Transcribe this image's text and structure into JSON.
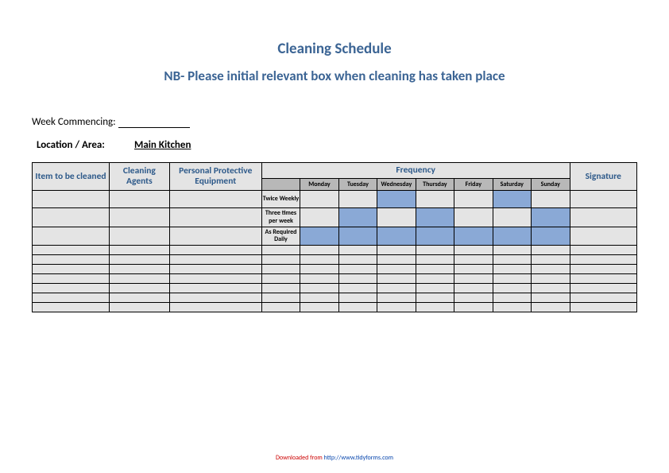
{
  "title": "Cleaning Schedule",
  "subtitle": "NB- Please initial relevant box when cleaning has taken place",
  "week_label": "Week Commencing:",
  "location_label": "Location / Area:",
  "location_value": "Main Kitchen",
  "headers": {
    "item": "Item to be cleaned",
    "agents": "Cleaning Agents",
    "ppe": "Personal Protective Equipment",
    "frequency": "Frequency",
    "signature": "Signature"
  },
  "days": [
    "Monday",
    "Tuesday",
    "Wednesday",
    "Thursday",
    "Friday",
    "Saturday",
    "Sunday"
  ],
  "freq_rows": [
    {
      "label": "Twice Weekly",
      "blue": [
        false,
        false,
        true,
        false,
        false,
        true,
        false
      ]
    },
    {
      "label": "Three times per week",
      "blue": [
        false,
        true,
        false,
        true,
        false,
        false,
        true
      ]
    },
    {
      "label": "As Required Daily",
      "blue": [
        true,
        true,
        true,
        true,
        true,
        true,
        true
      ]
    }
  ],
  "empty_row_count": 7,
  "footer_prefix": "Downloaded from ",
  "footer_link": "http://www.tidyforms.com"
}
